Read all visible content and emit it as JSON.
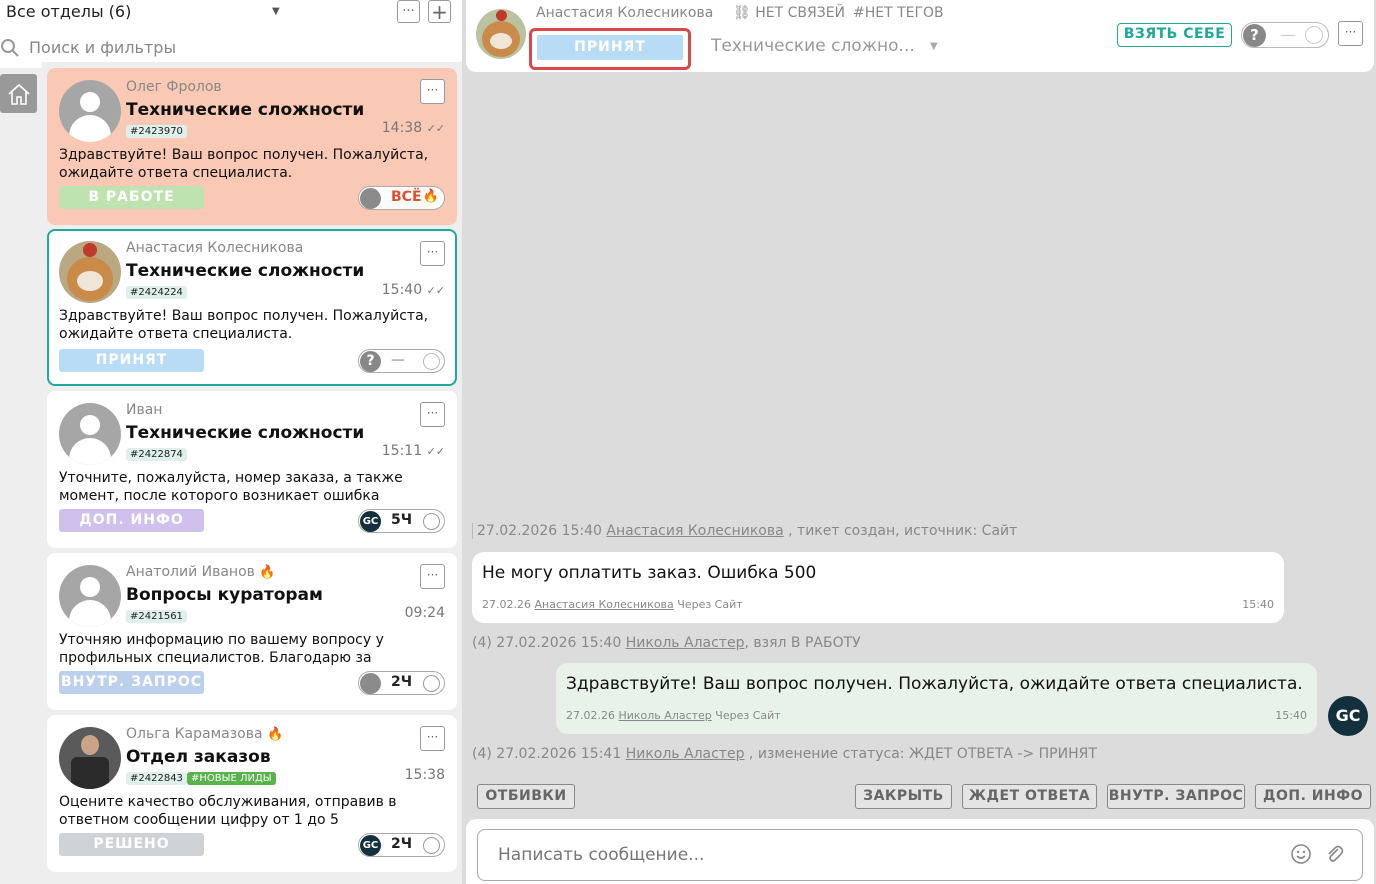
{
  "sidebar": {
    "department": "Все отделы (6)",
    "search_placeholder": "Поиск и фильтры"
  },
  "tickets": [
    {
      "name": "Олег Фролов",
      "topic": "Технические сложности",
      "id": "#2423970",
      "time": "14:38",
      "message": "Здравствуйте! Ваш вопрос получен. Пожалуйста, ожидайте ответа специалиста.",
      "status": "В РАБОТЕ",
      "status_color": "#bfe3b0",
      "pill_text": "ВСЁ",
      "card_color": "#f9c9b5"
    },
    {
      "name": "Анастасия Колесникова",
      "topic": "Технические сложности",
      "id": "#2424224",
      "time": "15:40",
      "message": "Здравствуйте! Ваш вопрос получен. Пожалуйста, ожидайте ответа специалиста.",
      "status": "ПРИНЯТ",
      "status_color": "#b9dcf6",
      "pill_text": "—"
    },
    {
      "name": "Иван",
      "topic": "Технические сложности",
      "id": "#2422874",
      "time": "15:11",
      "message": "Уточните, пожалуйста, номер заказа, а также момент, после которого возникает ошибка",
      "status": "ДОП. ИНФО",
      "status_color": "#cfc0ee",
      "pill_text": "5Ч"
    },
    {
      "name": "Анатолий Иванов",
      "topic": "Вопросы кураторам",
      "id": "#2421561",
      "time": "09:24",
      "message": "Уточняю информацию по вашему вопросу у профильных специалистов. Благодарю за ожидание.",
      "status": "ВНУТР. ЗАПРОС",
      "status_color": "#bcd0ee",
      "pill_text": "2Ч"
    },
    {
      "name": "Ольга Карамазова",
      "topic": "Отдел заказов",
      "id": "#2422843",
      "tag": "#НОВЫЕ ЛИДЫ",
      "time": "15:38",
      "message": "Оцените качество обслуживания, отправив в ответном сообщении цифру от 1 до 5",
      "status": "РЕШЕНО",
      "status_color": "#cfd3d6",
      "pill_text": "2Ч"
    }
  ],
  "header": {
    "name": "Анастасия Колесникова",
    "links": "НЕТ СВЯЗЕЙ",
    "tags": "#НЕТ ТЕГОВ",
    "status": "ПРИНЯТ",
    "topic": "Технические сложно...",
    "take_button": "ВЗЯТЬ СЕБЕ"
  },
  "chat": {
    "sys1_date": "27.02.2026 15:40",
    "sys1_user": "Анастасия Колесникова",
    "sys1_text": ", тикет создан, источник: Сайт",
    "msg1_text": "Не могу оплатить заказ. Ошибка 500",
    "msg1_date": "27.02.26",
    "msg1_user": "Анастасия Колесникова",
    "msg1_source": "Через Сайт",
    "msg1_time": "15:40",
    "sys2_prefix": "(4) 27.02.2026 15:40",
    "sys2_user": "Николь Аластер",
    "sys2_text": ", взял В РАБОТУ",
    "msg2_text": "Здравствуйте! Ваш вопрос получен. Пожалуйста, ожидайте ответа специалиста.",
    "msg2_date": "27.02.26",
    "msg2_user": "Николь Аластер",
    "msg2_source": "Через Сайт",
    "msg2_time": "15:40",
    "sys3_prefix": "(4) 27.02.2026 15:41",
    "sys3_user": "Николь Аластер",
    "sys3_text": ", изменение статуса: ЖДЕТ ОТВЕТА -> ПРИНЯТ"
  },
  "quick_buttons": {
    "otbivki": "ОТБИВКИ",
    "close": "ЗАКРЫТЬ",
    "wait": "ЖДЕТ ОТВЕТА",
    "internal": "ВНУТР. ЗАПРОС",
    "info": "ДОП. ИНФО"
  },
  "composer": {
    "placeholder": "Написать сообщение..."
  },
  "colors": {
    "accent": "#1fa99a",
    "highlight": "#d9484a"
  }
}
